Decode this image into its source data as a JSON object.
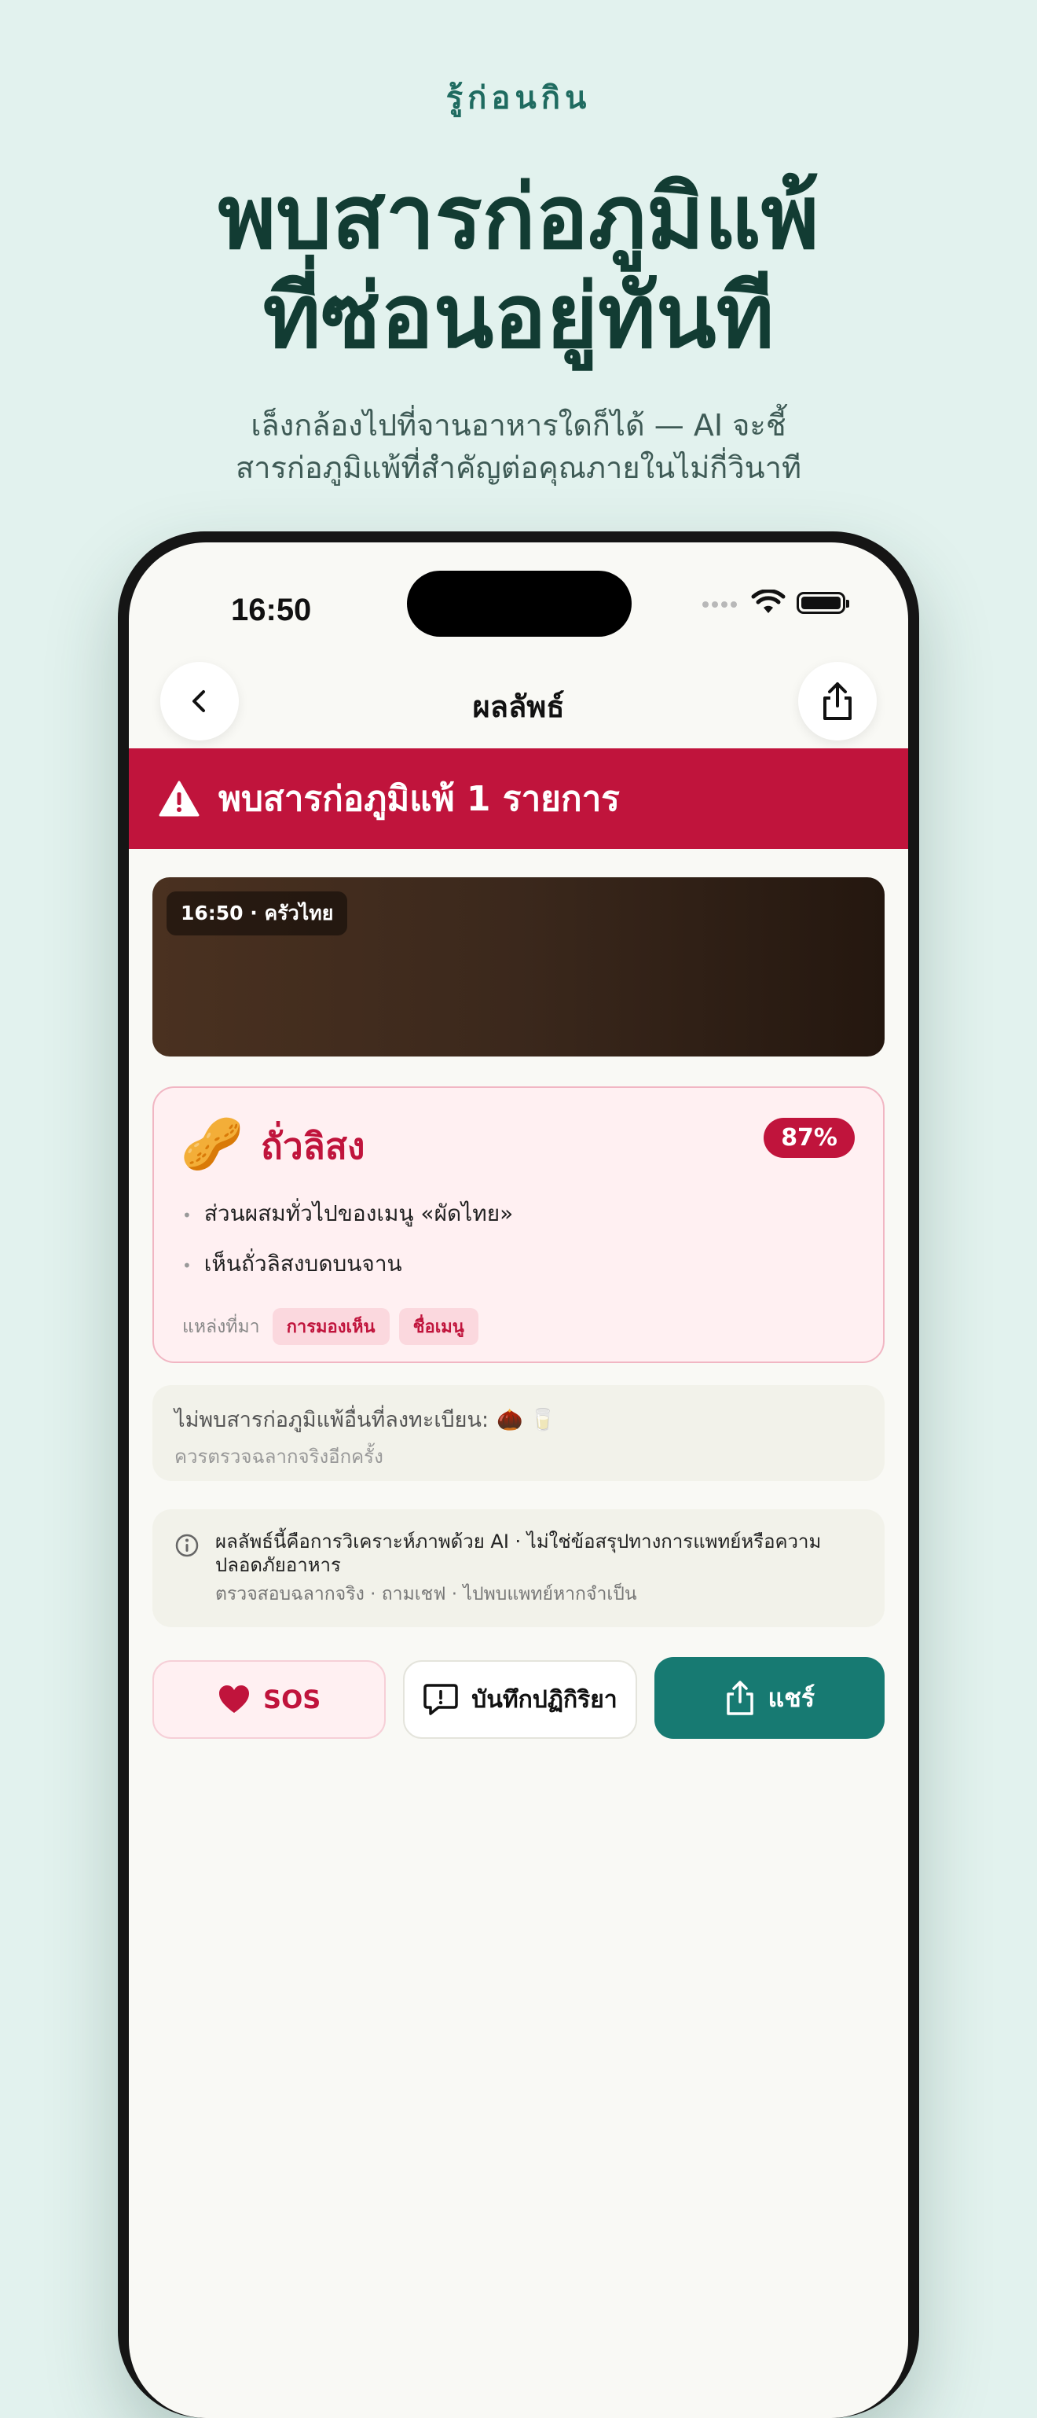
{
  "hero": {
    "eyebrow": "รู้ก่อนกิน",
    "title_line1": "พบสารก่อภูมิแพ้",
    "title_line2": "ที่ซ่อนอยู่ทันที",
    "subtitle_line1": "เล็งกล้องไปที่จานอาหารใดก็ได้ — AI จะชี้",
    "subtitle_line2": "สารก่อภูมิแพ้ที่สำคัญต่อคุณภายในไม่กี่วินาที"
  },
  "status_bar": {
    "time": "16:50"
  },
  "nav": {
    "title": "ผลลัพธ์",
    "back_icon": "chevron-left-icon",
    "share_icon": "share-icon"
  },
  "alert": {
    "text": "พบสารก่อภูมิแพ้ 1 รายการ",
    "color": "#c0143c"
  },
  "photo": {
    "tag": "16:50 · ครัวไทย"
  },
  "allergen": {
    "emoji": "🥜",
    "name": "ถั่วลิสง",
    "confidence": "87%",
    "reasons": [
      "ส่วนผสมทั่วไปของเมนู «ผัดไทย»",
      "เห็นถั่วลิสงบดบนจาน"
    ],
    "source_label": "แหล่งที่มา",
    "sources": [
      "การมองเห็น",
      "ชื่อเมนู"
    ]
  },
  "other": {
    "title": "ไม่พบสารก่อภูมิแพ้อื่นที่ลงทะเบียน:",
    "icons": "🌰 🥛",
    "subtitle": "ควรตรวจฉลากจริงอีกครั้ง"
  },
  "disclaimer": {
    "main": "ผลลัพธ์นี้คือการวิเคราะห์ภาพด้วย AI · ไม่ใช่ข้อสรุปทางการแพทย์หรือความปลอดภัยอาหาร",
    "sub": "ตรวจสอบฉลากจริง · ถามเชฟ · ไปพบแพทย์หากจำเป็น"
  },
  "actions": {
    "sos": "SOS",
    "log_reaction": "บันทึกปฏิกิริยา",
    "share": "แชร์"
  },
  "colors": {
    "accent": "#c0143c",
    "teal": "#177a72",
    "background": "#e2f2ee"
  }
}
